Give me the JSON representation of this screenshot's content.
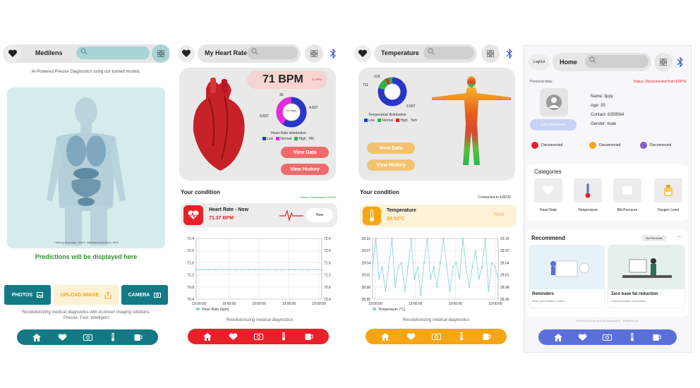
{
  "s1": {
    "title": "Medilens",
    "tagline": "AI-Powered Precise Diagnostics using our trained models.",
    "accuracy": "Training Accuracy: 100%, Validation Accuracy: 96%",
    "predictions": "Predictions will be displayed here",
    "photos_label": "PHOTOS",
    "upload_label": "UPLOAD IMAGE",
    "camera_label": "CAMERA",
    "footer": "Revolutionizing medical diagnostics with AI-driven imaging solutions. Precise. Fast. Intelligent"
  },
  "s2": {
    "title": "My Heart Rate",
    "bpm": "71 BPM",
    "bpm_unit": "61 BPM",
    "donut_top": "35",
    "donut_right": "4,837",
    "donut_left": "6,837",
    "donut_center": "29 days",
    "dist_title": "Heart Rate distribution",
    "legend": [
      "Low",
      "Normal",
      "High",
      "HR"
    ],
    "view_data": "View Data",
    "view_history": "View History",
    "condition": "Your condition",
    "status": "Status: Connected to ESP32",
    "card_title": "Heart Rate - Now",
    "card_value": "71.37 BPM",
    "now_btn": "Now",
    "footer": "Revolutionizing medical diagnostics",
    "series_label": "Heart Rate (bpm)"
  },
  "s3": {
    "title": "Temperature",
    "donut_top": "219",
    "donut_left": "711",
    "donut_right": "2,667",
    "dist_title": "Temperature distribution",
    "legend": [
      "Low",
      "Normal",
      "High",
      "Tem"
    ],
    "view_data": "View Data",
    "view_history": "View History",
    "condition": "Your condition",
    "status": "Connected to ESP32",
    "card_title": "Temperature",
    "card_value": "29.03°C",
    "now_btn": "Now",
    "footer": "Revolutionizing medical diagnostics",
    "series_label": "Temperature (°C)"
  },
  "s4": {
    "logout": "LogOut",
    "title": "Home",
    "personal": "Personal data:",
    "status": "Status: Disconnected from ESP32",
    "name": "Name: lippy",
    "age": "Age: 35",
    "contact": "Contact: 6359564",
    "gender": "Gender: male",
    "edit_btn": "Edit Information",
    "dev1": "Disconnected",
    "dev2": "Disconnected",
    "dev3": "Disconnected",
    "categories": "Categories",
    "cat": [
      "Heart Rate",
      "Temperature",
      "Bld Pressure",
      "Oxygen Level"
    ],
    "recommend": "Recommend",
    "set_reminder": "Set Reminder",
    "rec1_title": "Reminders",
    "rec1_sub": "Keep your health in check",
    "rec2_title": "Zero base fat reduction",
    "rec2_sub": "Course duration 20 minutes",
    "footer": "Revolutionizing medical diagnostics · Medilens inc."
  },
  "colors": {
    "red": "#e8202a",
    "orange": "#f5a516",
    "blue": "#5b6fd8",
    "teal": "#137a85",
    "green": "#2f8e2f"
  },
  "chart_data": [
    {
      "type": "line",
      "title": "",
      "series": [
        {
          "name": "Heart Rate (bpm)",
          "values": [
            71.37,
            71.37,
            71.37,
            71.37,
            71.37,
            71.37,
            71.37,
            71.37,
            71.37,
            71.37,
            71.37,
            71.37,
            71.37,
            71.37,
            71.37,
            71.37,
            71.37,
            71.37,
            71.37,
            71.37
          ]
        }
      ],
      "x_ticks": [
        "19:00:00",
        "19:00:00",
        "19:00:00",
        "19:00:00",
        "19:00:00"
      ],
      "y_ticks": [
        72.4,
        72.0,
        71.6,
        71.2,
        70.8,
        70.4
      ],
      "ylim": [
        70.4,
        72.4
      ]
    },
    {
      "type": "line",
      "title": "",
      "series": [
        {
          "name": "Temperature (°C)",
          "values": [
            29.03,
            29.1,
            29.0,
            29.03,
            28.97,
            29.03,
            29.1,
            28.98,
            29.03,
            29.04,
            28.97,
            29.03,
            29.1,
            29.0,
            29.03,
            28.96,
            29.04,
            29.1,
            29.0,
            29.03,
            28.98,
            29.04,
            29.1,
            29.03,
            28.97,
            29.03,
            29.04,
            29.0,
            29.1,
            29.03,
            28.98,
            29.03,
            29.07,
            29.0,
            29.03,
            29.1,
            28.97,
            29.04,
            29.03,
            29.0
          ]
        }
      ],
      "x_ticks": [
        "19:00:00",
        "19:00:00",
        "19:00:00",
        "19:00:00"
      ],
      "y_ticks": [
        29.1,
        29.07,
        29.04,
        29.01,
        28.98,
        28.95
      ],
      "ylim": [
        28.95,
        29.1
      ]
    }
  ]
}
